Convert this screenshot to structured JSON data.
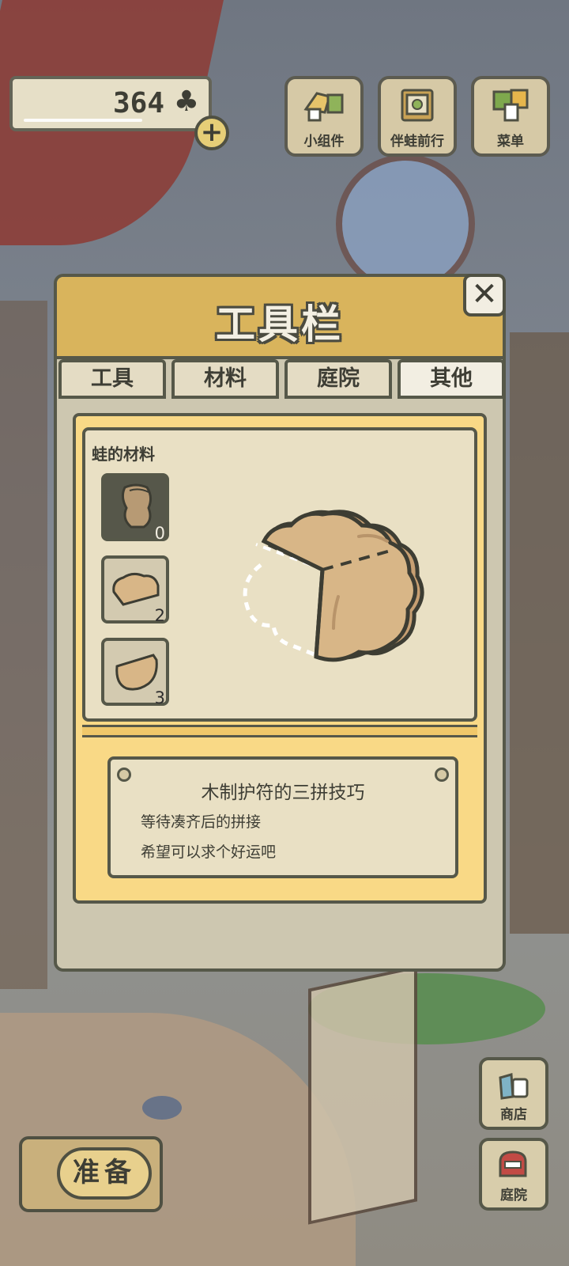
{
  "hud": {
    "clover_count": "364",
    "clover_icon": "clover-icon",
    "plus_label": "+",
    "top_buttons": [
      {
        "label": "小组件",
        "icon": "widget-icon"
      },
      {
        "label": "伴蛙前行",
        "icon": "travel-album-icon"
      },
      {
        "label": "菜单",
        "icon": "menu-cards-icon"
      }
    ]
  },
  "dialog": {
    "title": "工具栏",
    "close_label": "✕",
    "tabs": [
      {
        "label": "工具",
        "active": false
      },
      {
        "label": "材料",
        "active": false
      },
      {
        "label": "庭院",
        "active": false
      },
      {
        "label": "其他",
        "active": true
      }
    ],
    "category_label": "蛙的材料",
    "slots": [
      {
        "count": "0",
        "selected": true,
        "icon": "wood-amulet-piece-icon"
      },
      {
        "count": "2",
        "selected": false,
        "icon": "wood-amulet-piece-icon"
      },
      {
        "count": "3",
        "selected": false,
        "icon": "wood-amulet-piece-icon"
      }
    ],
    "description": {
      "title": "木制护符的三拼技巧",
      "lines": [
        "等待凑齐后的拼接",
        "希望可以求个好运吧"
      ]
    }
  },
  "bottom": {
    "prepare_label": "准备",
    "side_buttons": [
      {
        "label": "商店",
        "icon": "shop-bag-icon"
      },
      {
        "label": "庭院",
        "icon": "garden-mailbox-icon"
      }
    ]
  },
  "colors": {
    "panel_yellow": "#f9d986",
    "header_gold": "#d9b45c",
    "outline": "#565849",
    "wood": "#d8b687"
  }
}
